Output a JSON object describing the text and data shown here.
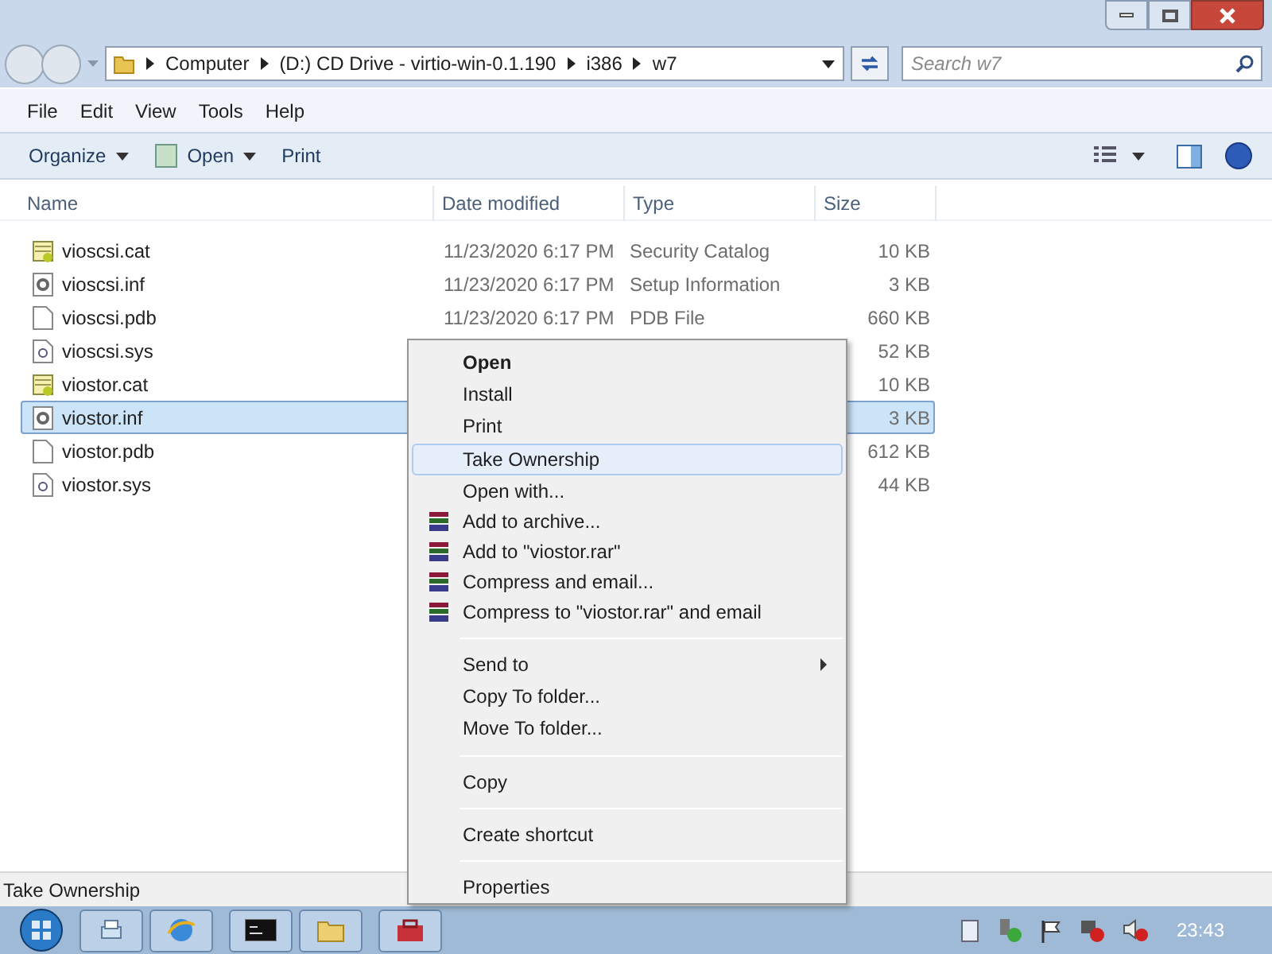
{
  "address_bar": {
    "segments": [
      "Computer",
      "(D:) CD Drive - virtio-win-0.1.190",
      "i386",
      "w7"
    ]
  },
  "search": {
    "placeholder": "Search w7"
  },
  "menu_bar": [
    "File",
    "Edit",
    "View",
    "Tools",
    "Help"
  ],
  "toolbar": [
    {
      "label": "Organize",
      "kind": "dropdown"
    },
    {
      "label": "Open",
      "kind": "open"
    },
    {
      "label": "Print",
      "kind": "plain"
    }
  ],
  "columns": [
    "Name",
    "Date modified",
    "Type",
    "Size"
  ],
  "files": [
    {
      "name": "vioscsi.cat",
      "kind": "catalog",
      "date": "11/23/2020 6:17 PM",
      "type": "Security Catalog",
      "size": "10 KB",
      "selected": false
    },
    {
      "name": "vioscsi.inf",
      "kind": "setup",
      "date": "11/23/2020 6:17 PM",
      "type": "Setup Information",
      "size": "3 KB",
      "selected": false
    },
    {
      "name": "vioscsi.pdb",
      "kind": "blank",
      "date": "11/23/2020 6:17 PM",
      "type": "PDB File",
      "size": "660 KB",
      "selected": false
    },
    {
      "name": "vioscsi.sys",
      "kind": "system",
      "size": "52 KB",
      "selected": false
    },
    {
      "name": "viostor.cat",
      "kind": "catalog",
      "size": "10 KB",
      "selected": false
    },
    {
      "name": "viostor.inf",
      "kind": "setup",
      "size": "3 KB",
      "selected": true
    },
    {
      "name": "viostor.pdb",
      "kind": "blank",
      "size": "612 KB",
      "selected": false
    },
    {
      "name": "viostor.sys",
      "kind": "system",
      "size": "44 KB",
      "selected": false
    }
  ],
  "context_menu": [
    {
      "kind": "command",
      "label": "Open",
      "default": true,
      "submenu": false,
      "selected": false
    },
    {
      "kind": "command",
      "label": "Install",
      "default": false,
      "submenu": false,
      "selected": false
    },
    {
      "kind": "command",
      "label": "Print",
      "default": false,
      "submenu": false,
      "selected": false
    },
    {
      "kind": "command",
      "label": "Take Ownership",
      "default": false,
      "submenu": false,
      "selected": true
    },
    {
      "kind": "command",
      "label": "Open with...",
      "default": false,
      "submenu": false,
      "selected": false
    },
    {
      "kind": "archive",
      "label": "Add to archive...",
      "default": false,
      "submenu": false,
      "selected": false
    },
    {
      "kind": "archive",
      "label": "Add to \"viostor.rar\"",
      "default": false,
      "submenu": false,
      "selected": false
    },
    {
      "kind": "archive",
      "label": "Compress and email...",
      "default": false,
      "submenu": false,
      "selected": false
    },
    {
      "kind": "archive",
      "label": "Compress to \"viostor.rar\" and email",
      "default": false,
      "submenu": false,
      "selected": false
    },
    {
      "kind": "separator"
    },
    {
      "kind": "command",
      "label": "Send to",
      "default": false,
      "submenu": true,
      "selected": false
    },
    {
      "kind": "command",
      "label": "Copy To folder...",
      "default": false,
      "submenu": false,
      "selected": false
    },
    {
      "kind": "command",
      "label": "Move To folder...",
      "default": false,
      "submenu": false,
      "selected": false
    },
    {
      "kind": "separator"
    },
    {
      "kind": "command",
      "label": "Copy",
      "default": false,
      "submenu": false,
      "selected": false
    },
    {
      "kind": "separator"
    },
    {
      "kind": "command",
      "label": "Create shortcut",
      "default": false,
      "submenu": false,
      "selected": false
    },
    {
      "kind": "separator"
    },
    {
      "kind": "command",
      "label": "Properties",
      "default": false,
      "submenu": false,
      "selected": false
    }
  ],
  "status_bar": {
    "text": "Take Ownership"
  },
  "taskbar": {
    "clock": "23:43"
  }
}
